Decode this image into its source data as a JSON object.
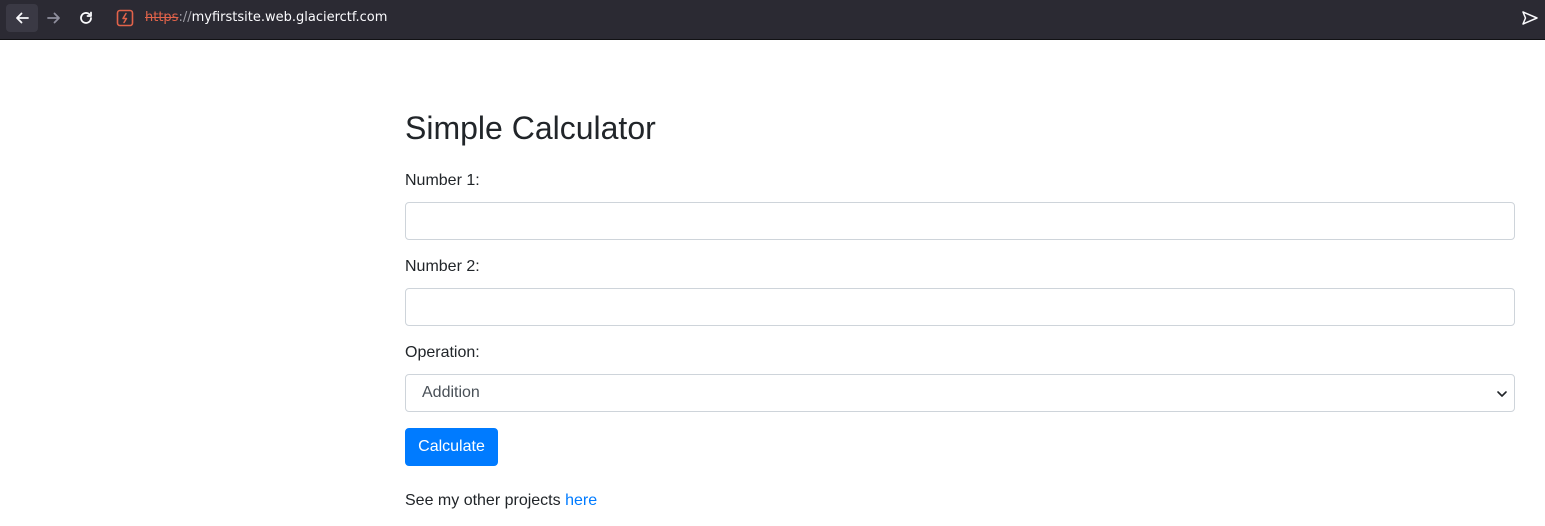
{
  "browser": {
    "url_scheme": "https",
    "url_separator": "://",
    "url_host": "myfirstsite.web.glacierctf.com",
    "icons": {
      "back": "arrow-left-icon",
      "forward": "arrow-right-icon",
      "reload": "reload-icon",
      "site": "insecure-site-icon",
      "send": "send-icon"
    },
    "colors": {
      "toolbar_bg": "#2b2a33",
      "insecure": "#e2634a"
    }
  },
  "page": {
    "title": "Simple Calculator",
    "number1_label": "Number 1:",
    "number1_value": "",
    "number2_label": "Number 2:",
    "number2_value": "",
    "operation_label": "Operation:",
    "operation_selected": "Addition",
    "calculate_label": "Calculate",
    "footer_text": "See my other projects ",
    "footer_link": "here",
    "colors": {
      "primary": "#007bff",
      "text": "#212529"
    }
  }
}
